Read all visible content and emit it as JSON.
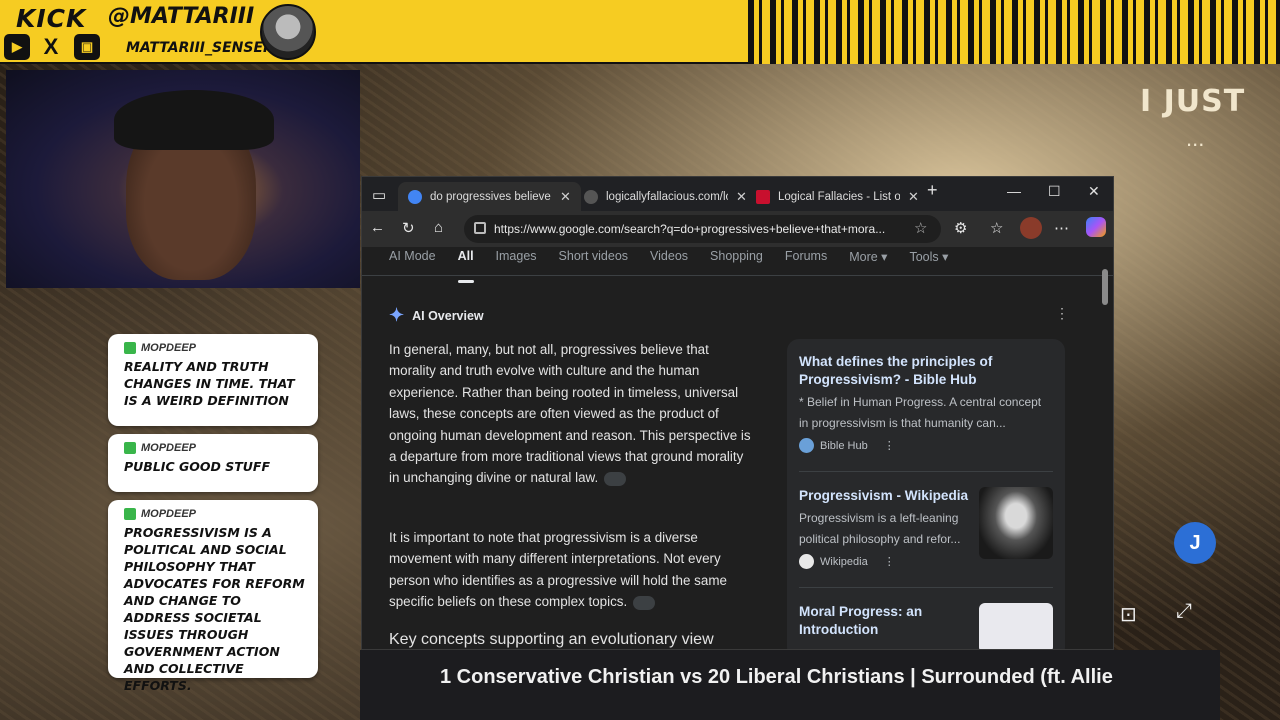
{
  "stream": {
    "platform": "KICK",
    "handle": "@MATTARIII",
    "sub_handle": "MATTARIII_SENSEI",
    "social": [
      "youtube-icon",
      "x-icon",
      "twitch-icon"
    ],
    "background_text": "I JUST",
    "background_dots": "...",
    "colors": {
      "banner": "#f6cc22",
      "dark": "#111111"
    }
  },
  "chat": [
    {
      "user": "MOPDEEP",
      "message": "REALITY AND TRUTH CHANGES IN TIME. THAT IS A WEIRD DEFINITION"
    },
    {
      "user": "MOPDEEP",
      "message": "PUBLIC GOOD STUFF"
    },
    {
      "user": "MOPDEEP",
      "message": "PROGRESSIVISM IS A POLITICAL AND SOCIAL PHILOSOPHY THAT ADVOCATES FOR REFORM AND CHANGE TO ADDRESS SOCIETAL ISSUES THROUGH GOVERNMENT ACTION AND COLLECTIVE EFFORTS."
    }
  ],
  "browser": {
    "tabs": [
      {
        "title": "do progressives believe t",
        "active": true,
        "favicon_color": "#4285f4"
      },
      {
        "title": "logicallyfallacious.com/lo",
        "active": false,
        "favicon_color": "#555555"
      },
      {
        "title": "Logical Fallacies - List of",
        "active": false,
        "favicon_color": "#c8102e"
      }
    ],
    "new_tab": "+",
    "url": "https://www.google.com/search?q=do+progressives+believe+that+mora..."
  },
  "search": {
    "tabs": [
      "AI Mode",
      "All",
      "Images",
      "Short videos",
      "Videos",
      "Shopping",
      "Forums",
      "More ▾",
      "Tools ▾"
    ],
    "active_tab": "All",
    "ai_overview_label": "AI Overview",
    "paragraphs": [
      "In general, many, but not all, progressives believe that morality and truth evolve with culture and the human experience. Rather than being rooted in timeless, universal laws, these concepts are often viewed as the product of ongoing human development and reason. This perspective is a departure from more traditional views that ground morality in unchanging divine or natural law.",
      "It is important to note that progressivism is a diverse movement with many different interpretations. Not every person who identifies as a progressive will hold the same specific beliefs on these complex topics."
    ],
    "subheading": "Key concepts supporting an evolutionary view",
    "sources": [
      {
        "title": "What defines the principles of Progressivism? - Bible Hub",
        "snippet": "* Belief in Human Progress. A central concept in progressivism is that humanity can...",
        "site": "Bible Hub"
      },
      {
        "title": "Progressivism - Wikipedia",
        "snippet": "Progressivism is a left-leaning political philosophy and refor...",
        "site": "Wikipedia"
      },
      {
        "title": "Moral Progress: an Introduction",
        "snippet": "",
        "site": ""
      }
    ]
  },
  "video": {
    "title": "1 Conservative Christian vs 20 Liberal Christians | Surrounded (ft. Allie"
  }
}
